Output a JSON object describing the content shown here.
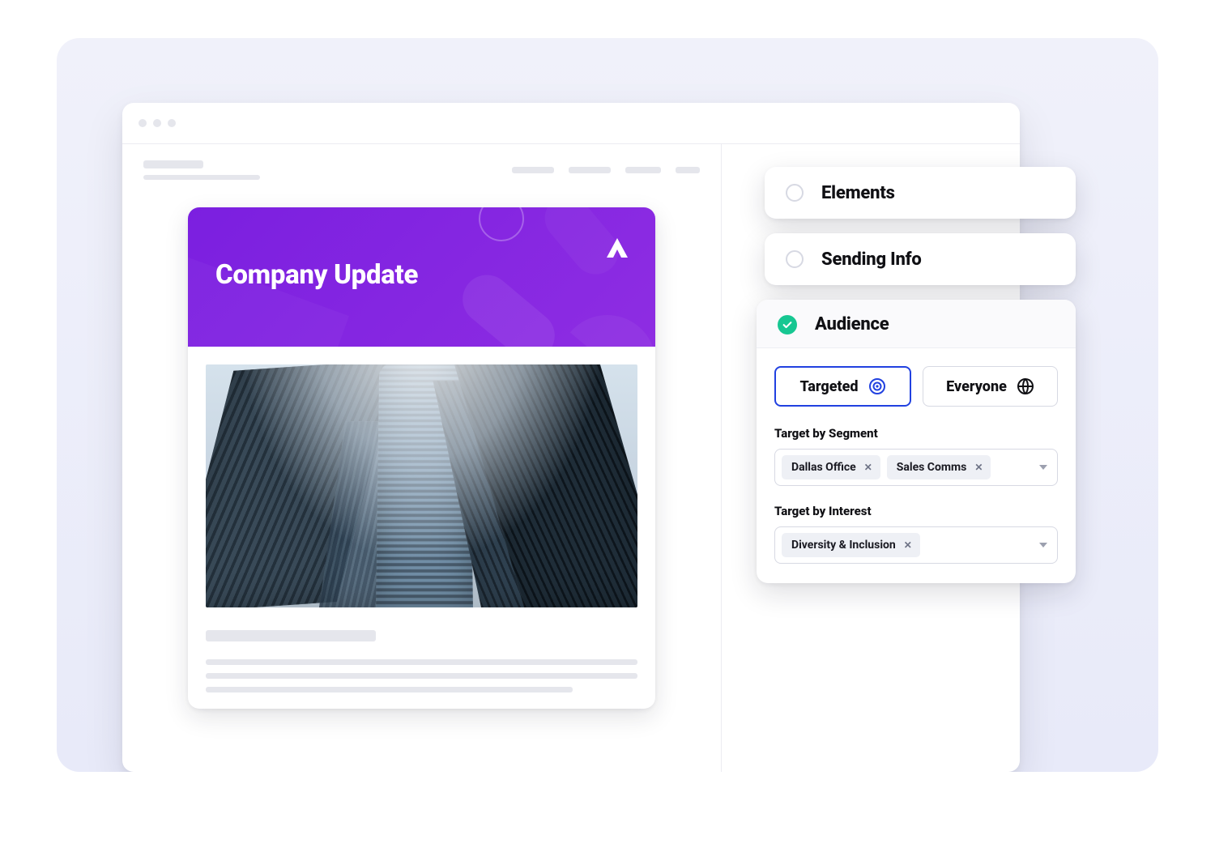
{
  "email": {
    "banner_title": "Company Update"
  },
  "panels": {
    "elements_label": "Elements",
    "sending_info_label": "Sending Info",
    "audience_label": "Audience"
  },
  "audience": {
    "toggle": {
      "targeted": "Targeted",
      "everyone": "Everyone",
      "selected": "targeted"
    },
    "segment": {
      "label": "Target by Segment",
      "tags": [
        "Dallas Office",
        "Sales Comms"
      ]
    },
    "interest": {
      "label": "Target by Interest",
      "tags": [
        "Diversity & Inclusion"
      ]
    }
  }
}
